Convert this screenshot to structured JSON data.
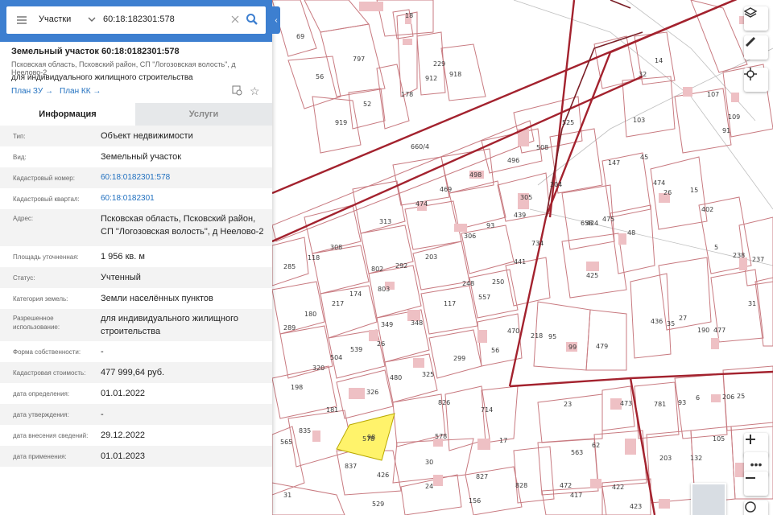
{
  "search": {
    "layer_label": "Участки",
    "query": "60:18:182301:578"
  },
  "parcel": {
    "title": "Земельный участок 60:18:0182301:578",
    "address": "Псковская область, Псковский район, СП \"Логозовская волость\", д Неелово-2",
    "use": "для индивидуального жилищного строительства",
    "plan_zu": "План ЗУ",
    "plan_kk": "План КК"
  },
  "tabs": {
    "info": "Информация",
    "services": "Услуги"
  },
  "rows": [
    {
      "key": "Тип:",
      "value": "Объект недвижимости"
    },
    {
      "key": "Вид:",
      "value": "Земельный участок"
    },
    {
      "key": "Кадастровый номер:",
      "value": "60:18:0182301:578"
    },
    {
      "key": "Кадастровый квартал:",
      "value": "60:18:0182301"
    },
    {
      "key": "Адрес:",
      "value": "Псковская область, Псковский район, СП \"Логозовская волость\", д Неелово-2"
    },
    {
      "key": "Площадь уточненная:",
      "value": "1 956 кв. м"
    },
    {
      "key": "Статус:",
      "value": "Учтенный"
    },
    {
      "key": "Категория земель:",
      "value": "Земли населённых пунктов"
    },
    {
      "key": "Разрешенное использование:",
      "value": "для индивидуального жилищного строительства"
    },
    {
      "key": "Форма собственности:",
      "value": "-"
    },
    {
      "key": "Кадастровая стоимость:",
      "value": "477 999,64 руб."
    },
    {
      "key": "дата определения:",
      "value": "01.01.2022"
    },
    {
      "key": "дата утверждения:",
      "value": "-"
    },
    {
      "key": "дата внесения сведений:",
      "value": "29.12.2022"
    },
    {
      "key": "дата применения:",
      "value": "01.01.2023"
    }
  ],
  "map": {
    "selected_parcel_label": "578",
    "selected_color": "#fff36b",
    "accent": "#3d7fd0",
    "parcel_labels": [
      "69",
      "797",
      "56",
      "52",
      "919",
      "912",
      "918",
      "178",
      "229",
      "18",
      "660/4",
      "525",
      "508",
      "496",
      "498",
      "469",
      "474",
      "313",
      "308",
      "118",
      "285",
      "304",
      "305",
      "93",
      "439",
      "306",
      "203",
      "292",
      "802",
      "803",
      "174",
      "217",
      "180",
      "289",
      "348",
      "117",
      "248",
      "250",
      "557",
      "441",
      "734",
      "349",
      "539",
      "504",
      "320",
      "26",
      "299",
      "56",
      "470",
      "218",
      "95",
      "99",
      "479",
      "480",
      "325",
      "326",
      "198",
      "181",
      "835",
      "565",
      "98",
      "578",
      "17",
      "714",
      "826",
      "837",
      "426",
      "30",
      "24",
      "31",
      "529",
      "156",
      "827",
      "828",
      "472",
      "422",
      "423",
      "417",
      "23",
      "563",
      "62",
      "473",
      "781",
      "93",
      "6",
      "206",
      "25",
      "203",
      "132",
      "105",
      "147",
      "45",
      "474",
      "475",
      "658",
      "424",
      "48",
      "425",
      "26",
      "15",
      "402",
      "5",
      "238",
      "237",
      "31",
      "103",
      "107",
      "91",
      "109",
      "32",
      "14",
      "35",
      "436",
      "27",
      "190",
      "477"
    ],
    "controls": [
      "layers-icon",
      "ruler-icon",
      "locate-icon",
      "zoom-in",
      "more",
      "zoom-out",
      "compass-icon"
    ]
  }
}
